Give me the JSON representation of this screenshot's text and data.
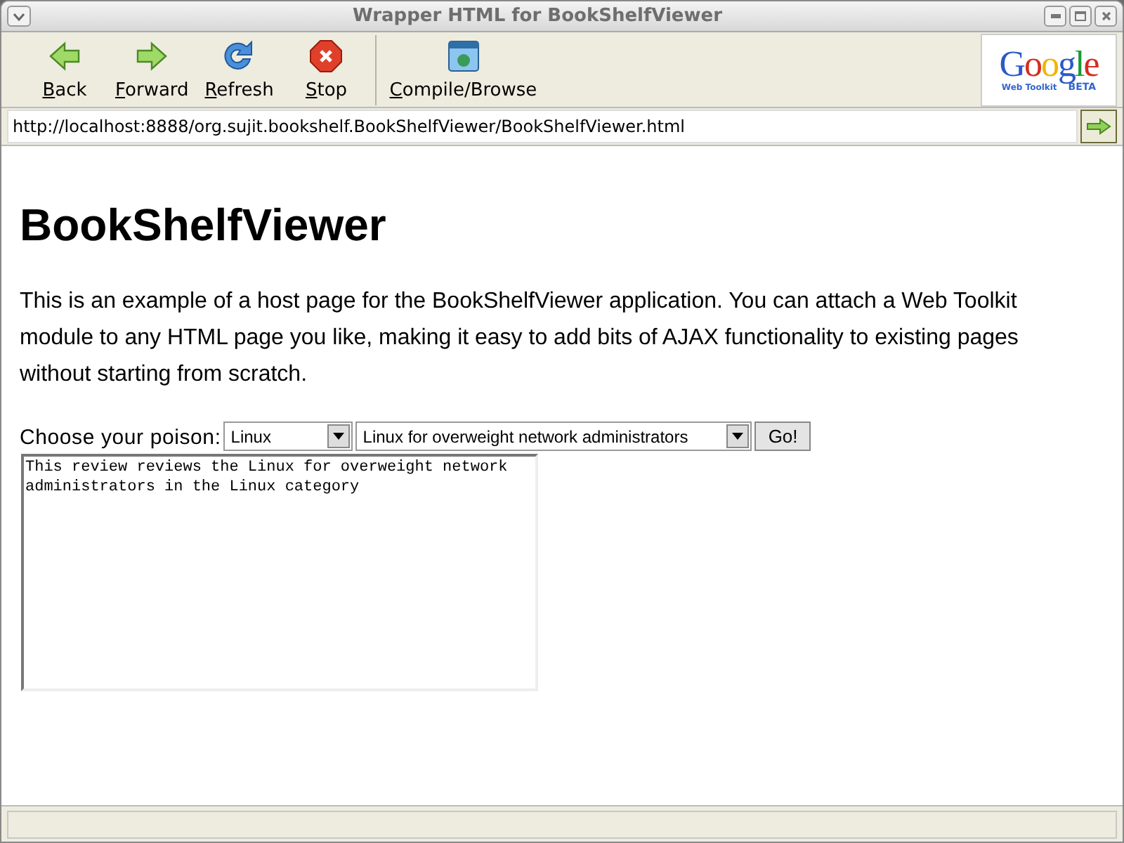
{
  "window": {
    "title": "Wrapper HTML for BookShelfViewer"
  },
  "toolbar": [
    {
      "kind": "back",
      "label": "Back"
    },
    {
      "kind": "forward",
      "label": "Forward"
    },
    {
      "kind": "refresh",
      "label": "Refresh"
    },
    {
      "kind": "stop",
      "label": "Stop"
    },
    {
      "kind": "compile",
      "label": "Compile/Browse"
    }
  ],
  "logo": {
    "wordmark": "Google",
    "subtitle": "Web Toolkit",
    "tag": "BETA"
  },
  "address": {
    "value": "http://localhost:8888/org.sujit.bookshelf.BookShelfViewer/BookShelfViewer.html"
  },
  "page": {
    "heading": "BookShelfViewer",
    "paragraph": "This is an example of a host page for the BookShelfViewer application. You can attach a Web Toolkit module to any HTML page you like, making it easy to add bits of AJAX functionality to existing pages without starting from scratch.",
    "prompt": "Choose your poison:",
    "category": "Linux",
    "title": "Linux for overweight network administrators",
    "button": "Go!",
    "review": "This review reviews the Linux for overweight network administrators in the Linux category"
  }
}
